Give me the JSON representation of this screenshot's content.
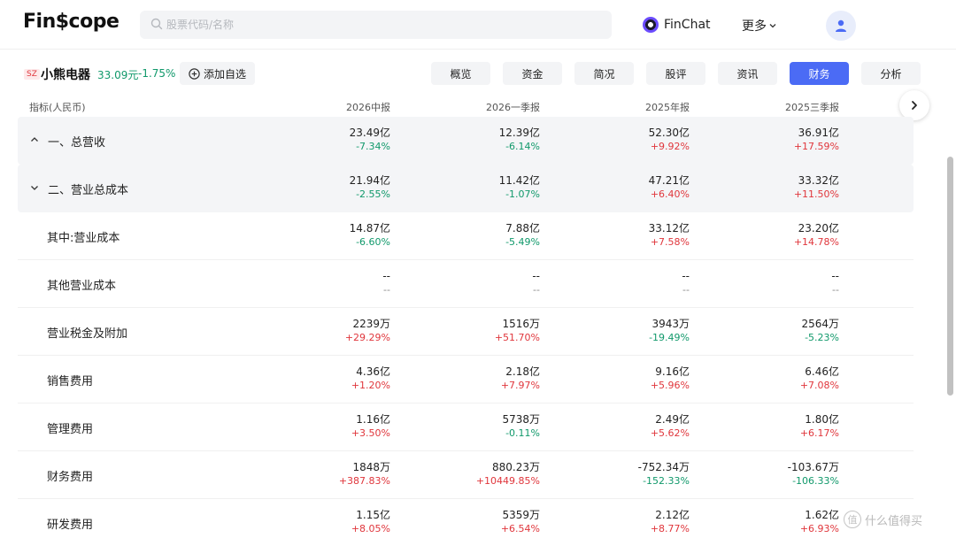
{
  "header": {
    "logo": "Fin$cope",
    "search_placeholder": "股票代码/名称",
    "finchat_label": "FinChat",
    "more_label": "更多"
  },
  "stock": {
    "market": "SZ",
    "name": "小熊电器",
    "price": "33.09元",
    "change": "-1.75%",
    "watch_label": "添加自选"
  },
  "tabs": [
    {
      "label": "概览",
      "active": false
    },
    {
      "label": "资金",
      "active": false
    },
    {
      "label": "简况",
      "active": false
    },
    {
      "label": "股评",
      "active": false
    },
    {
      "label": "资讯",
      "active": false
    },
    {
      "label": "财务",
      "active": true
    },
    {
      "label": "分析",
      "active": false
    }
  ],
  "table": {
    "indicator_label": "指标(人民币)",
    "periods": [
      "2026中报",
      "2026一季报",
      "2025年报",
      "2025三季报"
    ],
    "rows": [
      {
        "name": "一、总营收",
        "kind": "group",
        "expanded": true,
        "cells": [
          {
            "v": "23.49亿",
            "p": "-7.34%",
            "dir": "down"
          },
          {
            "v": "12.39亿",
            "p": "-6.14%",
            "dir": "down"
          },
          {
            "v": "52.30亿",
            "p": "+9.92%",
            "dir": "up"
          },
          {
            "v": "36.91亿",
            "p": "+17.59%",
            "dir": "up"
          }
        ]
      },
      {
        "name": "二、营业总成本",
        "kind": "group",
        "expanded": false,
        "cells": [
          {
            "v": "21.94亿",
            "p": "-2.55%",
            "dir": "down"
          },
          {
            "v": "11.42亿",
            "p": "-1.07%",
            "dir": "down"
          },
          {
            "v": "47.21亿",
            "p": "+6.40%",
            "dir": "up"
          },
          {
            "v": "33.32亿",
            "p": "+11.50%",
            "dir": "up"
          }
        ]
      },
      {
        "name": "其中:营业成本",
        "kind": "sub",
        "cells": [
          {
            "v": "14.87亿",
            "p": "-6.60%",
            "dir": "down"
          },
          {
            "v": "7.88亿",
            "p": "-5.49%",
            "dir": "down"
          },
          {
            "v": "33.12亿",
            "p": "+7.58%",
            "dir": "up"
          },
          {
            "v": "23.20亿",
            "p": "+14.78%",
            "dir": "up"
          }
        ]
      },
      {
        "name": "其他营业成本",
        "kind": "sub",
        "cells": [
          {
            "v": "--",
            "p": "--",
            "dir": "flat"
          },
          {
            "v": "--",
            "p": "--",
            "dir": "flat"
          },
          {
            "v": "--",
            "p": "--",
            "dir": "flat"
          },
          {
            "v": "--",
            "p": "--",
            "dir": "flat"
          }
        ]
      },
      {
        "name": "营业税金及附加",
        "kind": "sub",
        "cells": [
          {
            "v": "2239万",
            "p": "+29.29%",
            "dir": "up"
          },
          {
            "v": "1516万",
            "p": "+51.70%",
            "dir": "up"
          },
          {
            "v": "3943万",
            "p": "-19.49%",
            "dir": "down"
          },
          {
            "v": "2564万",
            "p": "-5.23%",
            "dir": "down"
          }
        ]
      },
      {
        "name": "销售费用",
        "kind": "sub",
        "cells": [
          {
            "v": "4.36亿",
            "p": "+1.20%",
            "dir": "up"
          },
          {
            "v": "2.18亿",
            "p": "+7.97%",
            "dir": "up"
          },
          {
            "v": "9.16亿",
            "p": "+5.96%",
            "dir": "up"
          },
          {
            "v": "6.46亿",
            "p": "+7.08%",
            "dir": "up"
          }
        ]
      },
      {
        "name": "管理费用",
        "kind": "sub",
        "cells": [
          {
            "v": "1.16亿",
            "p": "+3.50%",
            "dir": "up"
          },
          {
            "v": "5738万",
            "p": "-0.11%",
            "dir": "down"
          },
          {
            "v": "2.49亿",
            "p": "+5.62%",
            "dir": "up"
          },
          {
            "v": "1.80亿",
            "p": "+6.17%",
            "dir": "up"
          }
        ]
      },
      {
        "name": "财务费用",
        "kind": "sub",
        "cells": [
          {
            "v": "1848万",
            "p": "+387.83%",
            "dir": "up"
          },
          {
            "v": "880.23万",
            "p": "+10449.85%",
            "dir": "up"
          },
          {
            "v": "-752.34万",
            "p": "-152.33%",
            "dir": "down"
          },
          {
            "v": "-103.67万",
            "p": "-106.33%",
            "dir": "down"
          }
        ]
      },
      {
        "name": "研发费用",
        "kind": "sub",
        "cells": [
          {
            "v": "1.15亿",
            "p": "+8.05%",
            "dir": "up"
          },
          {
            "v": "5359万",
            "p": "+6.54%",
            "dir": "up"
          },
          {
            "v": "2.12亿",
            "p": "+8.77%",
            "dir": "up"
          },
          {
            "v": "1.62亿",
            "p": "+6.93%",
            "dir": "up"
          }
        ]
      }
    ]
  },
  "watermark": "什么值得买",
  "colors": {
    "accent": "#4b6bf5",
    "up": "#e0363c",
    "down": "#11996b"
  }
}
